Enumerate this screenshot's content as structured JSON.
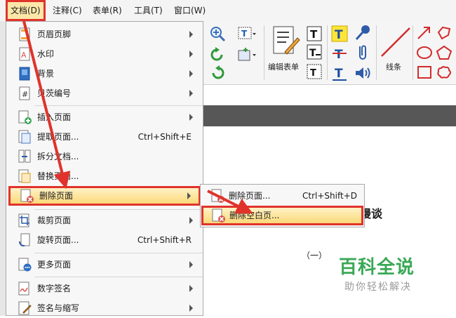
{
  "menubar": {
    "items": [
      "文档(D)",
      "注释(C)",
      "表单(R)",
      "工具(T)",
      "窗口(W)"
    ]
  },
  "toolbar": {
    "form_label": "编辑表单",
    "line_label": "线条"
  },
  "dropdown": {
    "items": [
      {
        "label": "页眉页脚",
        "shortcut": ""
      },
      {
        "label": "水印",
        "shortcut": ""
      },
      {
        "label": "背景",
        "shortcut": ""
      },
      {
        "label": "贝茨编号",
        "shortcut": ""
      },
      {
        "label": "插入页面",
        "shortcut": ""
      },
      {
        "label": "提取页面...",
        "shortcut": "Ctrl+Shift+E"
      },
      {
        "label": "拆分文档...",
        "shortcut": ""
      },
      {
        "label": "替换页面...",
        "shortcut": ""
      },
      {
        "label": "删除页面",
        "shortcut": ""
      },
      {
        "label": "裁剪页面",
        "shortcut": ""
      },
      {
        "label": "旋转页面...",
        "shortcut": "Ctrl+Shift+R"
      },
      {
        "label": "更多页面",
        "shortcut": ""
      },
      {
        "label": "数字签名",
        "shortcut": ""
      },
      {
        "label": "签名与缩写",
        "shortcut": ""
      }
    ]
  },
  "submenu": {
    "items": [
      {
        "label": "删除页面...",
        "shortcut": "Ctrl+Shift+D"
      },
      {
        "label": "删除空白页...",
        "shortcut": ""
      }
    ]
  },
  "document": {
    "title_fragment": "漫谈",
    "subtitle": "（一）"
  },
  "watermark": {
    "main": "百科全说",
    "sub": "助你轻松解决"
  },
  "colors": {
    "highlight_border": "#e0332b",
    "highlight_fill": "#fbd979",
    "watermark_green": "#3aa856"
  }
}
